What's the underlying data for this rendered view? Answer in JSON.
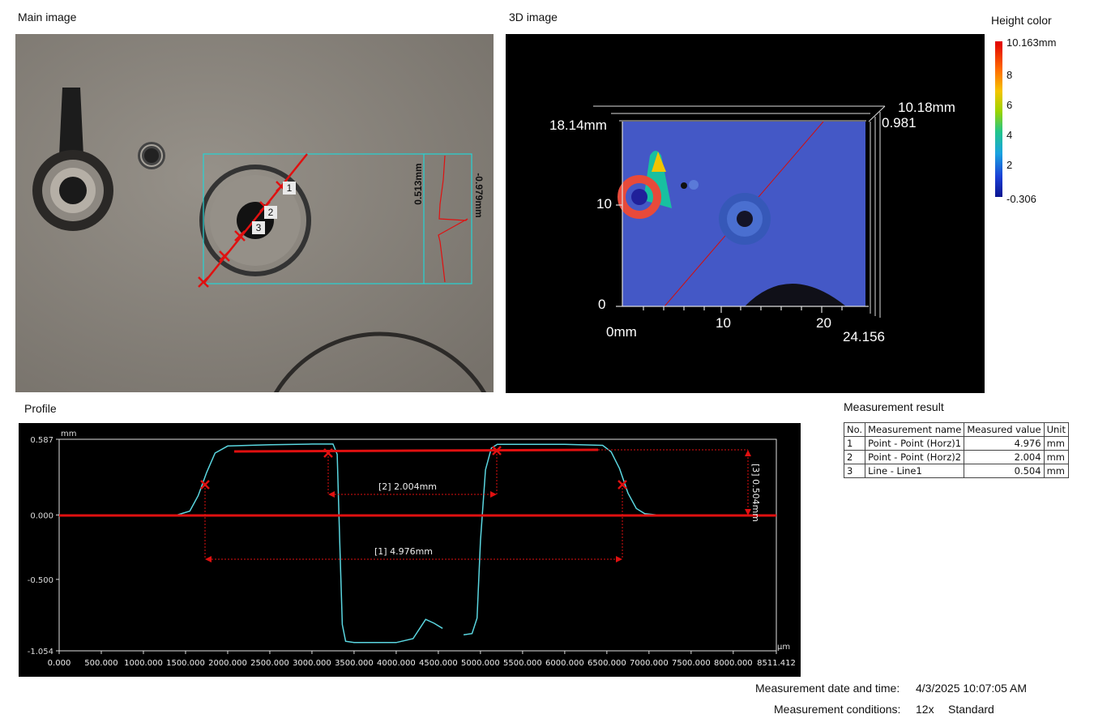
{
  "sections": {
    "main_image": "Main image",
    "image_3d": "3D image",
    "height_color": "Height color",
    "profile": "Profile",
    "measurement_result": "Measurement result"
  },
  "main_image": {
    "marker_labels": [
      "1",
      "2",
      "3"
    ],
    "height_top": "0.513mm",
    "height_bottom": "-0.979mm"
  },
  "view_3d": {
    "top_left_label": "18.14mm",
    "top_right_label": "10.18mm",
    "top_right_value": "0.981",
    "y_ticks": [
      "10",
      "0"
    ],
    "x_origin": "0mm",
    "x_ticks": [
      "10",
      "20"
    ],
    "x_end": "24.156"
  },
  "height_color": {
    "max": "10.163mm",
    "ticks": [
      "8",
      "6",
      "4",
      "2"
    ],
    "min": "-0.306"
  },
  "chart_data": {
    "type": "line",
    "y_unit": "mm",
    "x_unit": "µm",
    "ylim": [
      -1.054,
      0.587
    ],
    "xlim": [
      0,
      8511.412
    ],
    "y_ticks": [
      "0.587",
      "0.000",
      "-0.500",
      "-1.054"
    ],
    "x_ticks": [
      "0.000",
      "500.000",
      "1000.000",
      "1500.000",
      "2000.000",
      "2500.000",
      "3000.000",
      "3500.000",
      "4000.000",
      "4500.000",
      "5000.000",
      "5500.000",
      "6000.000",
      "6500.000",
      "7000.000",
      "7500.000",
      "8000.000",
      "8511.412"
    ],
    "series": [
      {
        "x": [
          0,
          1400,
          1550,
          1650,
          1750,
          1850,
          2000,
          2500,
          3000,
          3250,
          3300,
          3330,
          3360,
          3400,
          3500,
          4000,
          4200,
          4350,
          4450,
          4550
        ],
        "y": [
          0,
          0,
          0.03,
          0.15,
          0.33,
          0.48,
          0.535,
          0.545,
          0.55,
          0.55,
          0.47,
          -0.2,
          -0.85,
          -0.98,
          -0.99,
          -0.99,
          -0.96,
          -0.81,
          -0.84,
          -0.88
        ]
      },
      {
        "x": [
          4800,
          4900,
          4960,
          5000,
          5060,
          5130,
          5200,
          5500,
          6000,
          6450,
          6550,
          6650,
          6750,
          6850,
          6950,
          7100,
          8511.412
        ],
        "y": [
          -0.93,
          -0.92,
          -0.8,
          -0.2,
          0.35,
          0.52,
          0.548,
          0.548,
          0.548,
          0.54,
          0.49,
          0.36,
          0.17,
          0.05,
          0.01,
          0,
          0
        ]
      }
    ],
    "annotations": [
      "[2] 2.004mm",
      "[1] 4.976mm",
      "[3] 0.504mm"
    ]
  },
  "measurement_table": {
    "headers": [
      "No.",
      "Measurement name",
      "Measured value",
      "Unit"
    ],
    "rows": [
      [
        "1",
        "Point - Point (Horz)1",
        "4.976",
        "mm"
      ],
      [
        "2",
        "Point - Point (Horz)2",
        "2.004",
        "mm"
      ],
      [
        "3",
        "Line - Line1",
        "0.504",
        "mm"
      ]
    ]
  },
  "meta": {
    "date_label": "Measurement date and time:",
    "date_value": "4/3/2025 10:07:05 AM",
    "cond_label": "Measurement conditions:",
    "cond_zoom": "12x",
    "cond_mode": "Standard"
  }
}
